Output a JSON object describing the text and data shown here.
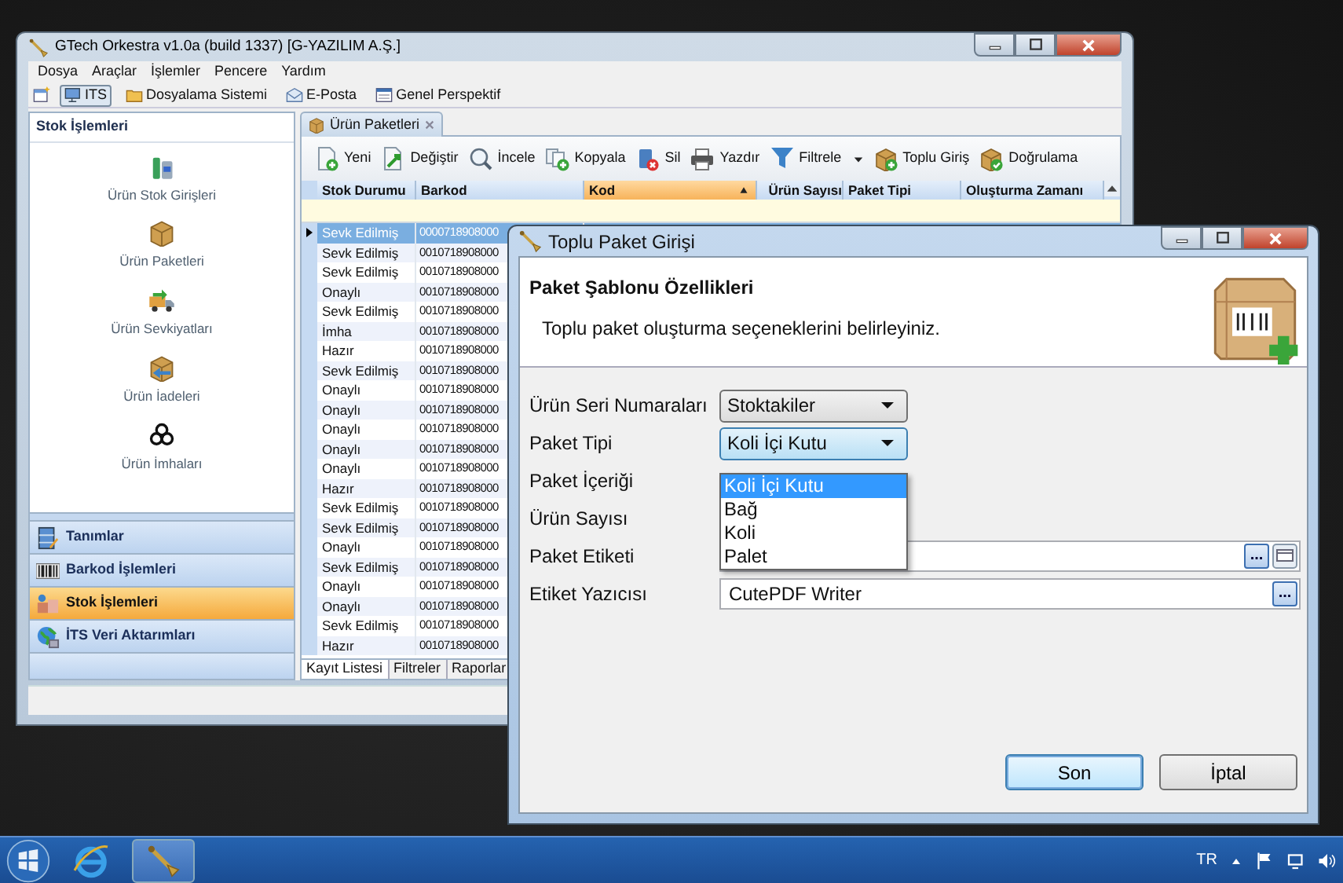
{
  "main_window": {
    "title": "GTech Orkestra v1.0a (build 1337) [G-YAZILIM A.Ş.]",
    "menu": [
      "Dosya",
      "Araçlar",
      "İşlemler",
      "Pencere",
      "Yardım"
    ],
    "perspectives": [
      {
        "label": "ITS",
        "selected": true
      },
      {
        "label": "Dosyalama Sistemi",
        "selected": false
      },
      {
        "label": "E-Posta",
        "selected": false
      },
      {
        "label": "Genel Perspektif",
        "selected": false
      }
    ],
    "navigator": {
      "title": "Stok İşlemleri",
      "items": [
        "Ürün Stok Girişleri",
        "Ürün Paketleri",
        "Ürün Sevkiyatları",
        "Ürün İadeleri",
        "Ürün İmhaları"
      ],
      "groups": [
        {
          "label": "Tanımlar",
          "selected": false
        },
        {
          "label": "Barkod İşlemleri",
          "selected": false
        },
        {
          "label": "Stok İşlemleri",
          "selected": true
        },
        {
          "label": "İTS Veri Aktarımları",
          "selected": false
        }
      ]
    },
    "editor": {
      "tab": "Ürün Paketleri",
      "toolbar": [
        {
          "label": "Yeni",
          "dropdown": false
        },
        {
          "label": "Değiştir",
          "dropdown": false
        },
        {
          "label": "İncele",
          "dropdown": false
        },
        {
          "label": "Kopyala",
          "dropdown": false
        },
        {
          "label": "Sil",
          "dropdown": false
        },
        {
          "label": "Yazdır",
          "dropdown": false
        },
        {
          "label": "Filtrele",
          "dropdown": true
        },
        {
          "label": "Toplu Giriş",
          "dropdown": false
        },
        {
          "label": "Doğrulama",
          "dropdown": false
        }
      ],
      "columns": [
        {
          "label": "Stok Durumu",
          "sorted": false
        },
        {
          "label": "Barkod",
          "sorted": false
        },
        {
          "label": "Kod",
          "sorted": true
        },
        {
          "label": "Ürün Sayısı",
          "sorted": false
        },
        {
          "label": "Paket Tipi",
          "sorted": false
        },
        {
          "label": "Oluşturma Zamanı",
          "sorted": false
        }
      ],
      "rows": [
        {
          "status": "Sevk Edilmiş",
          "barcode": "0000718908000",
          "selected": true
        },
        {
          "status": "Sevk Edilmiş",
          "barcode": "0010718908000",
          "selected": false
        },
        {
          "status": "Sevk Edilmiş",
          "barcode": "0010718908000",
          "selected": false
        },
        {
          "status": "Onaylı",
          "barcode": "0010718908000",
          "selected": false
        },
        {
          "status": "Sevk Edilmiş",
          "barcode": "0010718908000",
          "selected": false
        },
        {
          "status": "İmha",
          "barcode": "0010718908000",
          "selected": false
        },
        {
          "status": "Hazır",
          "barcode": "0010718908000",
          "selected": false
        },
        {
          "status": "Sevk Edilmiş",
          "barcode": "0010718908000",
          "selected": false
        },
        {
          "status": "Onaylı",
          "barcode": "0010718908000",
          "selected": false
        },
        {
          "status": "Onaylı",
          "barcode": "0010718908000",
          "selected": false
        },
        {
          "status": "Onaylı",
          "barcode": "0010718908000",
          "selected": false
        },
        {
          "status": "Onaylı",
          "barcode": "0010718908000",
          "selected": false
        },
        {
          "status": "Onaylı",
          "barcode": "0010718908000",
          "selected": false
        },
        {
          "status": "Hazır",
          "barcode": "0010718908000",
          "selected": false
        },
        {
          "status": "Sevk Edilmiş",
          "barcode": "0010718908000",
          "selected": false
        },
        {
          "status": "Sevk Edilmiş",
          "barcode": "0010718908000",
          "selected": false
        },
        {
          "status": "Onaylı",
          "barcode": "0010718908000",
          "selected": false
        },
        {
          "status": "Sevk Edilmiş",
          "barcode": "0010718908000",
          "selected": false
        },
        {
          "status": "Onaylı",
          "barcode": "0010718908000",
          "selected": false
        },
        {
          "status": "Onaylı",
          "barcode": "0010718908000",
          "selected": false
        },
        {
          "status": "Sevk Edilmiş",
          "barcode": "0010718908000",
          "selected": false
        },
        {
          "status": "Hazır",
          "barcode": "0010718908000",
          "selected": false
        }
      ],
      "bottom_tabs": [
        {
          "label": "Kayıt Listesi",
          "selected": true
        },
        {
          "label": "Filtreler",
          "selected": false
        },
        {
          "label": "Raporlar",
          "selected": false
        }
      ]
    }
  },
  "dialog": {
    "title": "Toplu Paket Girişi",
    "heading": "Paket Şablonu Özellikleri",
    "description": "Toplu paket oluşturma seçeneklerini belirleyiniz.",
    "fields": [
      {
        "label": "Ürün Seri Numaraları",
        "kind": "combo",
        "value": "Stoktakiler",
        "expanded": false
      },
      {
        "label": "Paket Tipi",
        "kind": "combo",
        "value": "Koli İçi Kutu",
        "expanded": true,
        "options": [
          {
            "label": "Koli İçi Kutu",
            "selected": true
          },
          {
            "label": "Bağ",
            "selected": false
          },
          {
            "label": "Koli",
            "selected": false
          },
          {
            "label": "Palet",
            "selected": false
          }
        ]
      },
      {
        "label": "Paket İçeriği",
        "kind": "label"
      },
      {
        "label": "Ürün Sayısı",
        "kind": "label"
      },
      {
        "label": "Paket Etiketi",
        "kind": "file",
        "browse": "..."
      },
      {
        "label": "Etiket Yazıcısı",
        "kind": "picker",
        "value": "CutePDF Writer",
        "browse": "..."
      }
    ],
    "buttons": [
      {
        "label": "Son",
        "default": true
      },
      {
        "label": "İptal",
        "default": false
      }
    ]
  },
  "taskbar": {
    "apps": [
      {
        "kind": "browser",
        "active": false
      },
      {
        "kind": "app",
        "active": true
      }
    ],
    "language": "TR"
  }
}
